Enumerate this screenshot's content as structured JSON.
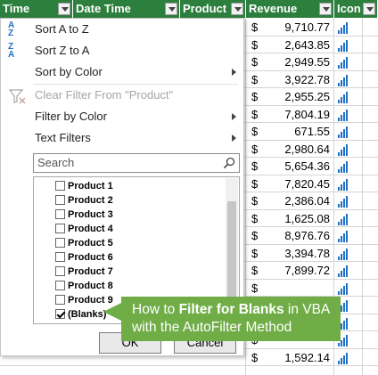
{
  "headers": {
    "time": "Time",
    "date_time": "Date Time",
    "product": "Product",
    "revenue": "Revenue",
    "icon": "Icon"
  },
  "revenue_rows": [
    {
      "cur": "$",
      "value": "9,710.77"
    },
    {
      "cur": "$",
      "value": "2,643.85"
    },
    {
      "cur": "$",
      "value": "2,949.55"
    },
    {
      "cur": "$",
      "value": "3,922.78"
    },
    {
      "cur": "$",
      "value": "2,955.25"
    },
    {
      "cur": "$",
      "value": "7,804.19"
    },
    {
      "cur": "$",
      "value": "671.55"
    },
    {
      "cur": "$",
      "value": "2,980.64"
    },
    {
      "cur": "$",
      "value": "5,654.36"
    },
    {
      "cur": "$",
      "value": "7,820.45"
    },
    {
      "cur": "$",
      "value": "2,386.04"
    },
    {
      "cur": "$",
      "value": "1,625.08"
    },
    {
      "cur": "$",
      "value": "8,976.76"
    },
    {
      "cur": "$",
      "value": "3,394.78"
    },
    {
      "cur": "$",
      "value": "7,899.72"
    },
    {
      "cur": "$",
      "value": ""
    },
    {
      "cur": "$",
      "value": ""
    },
    {
      "cur": "$",
      "value": ""
    },
    {
      "cur": "$",
      "value": ""
    },
    {
      "cur": "$",
      "value": "1,592.14"
    }
  ],
  "menu": {
    "sort_a_z": "Sort A to Z",
    "sort_z_a": "Sort Z to A",
    "sort_by_color": "Sort by Color",
    "clear_filter": "Clear Filter From \"Product\"",
    "filter_by_color": "Filter by Color",
    "text_filters": "Text Filters",
    "search_placeholder": "Search",
    "ok": "OK",
    "cancel": "Cancel"
  },
  "filter_items": [
    {
      "label": "Product 1",
      "checked": false
    },
    {
      "label": "Product 2",
      "checked": false
    },
    {
      "label": "Product 3",
      "checked": false
    },
    {
      "label": "Product 4",
      "checked": false
    },
    {
      "label": "Product 5",
      "checked": false
    },
    {
      "label": "Product 6",
      "checked": false
    },
    {
      "label": "Product 7",
      "checked": false
    },
    {
      "label": "Product 8",
      "checked": false
    },
    {
      "label": "Product 9",
      "checked": false
    },
    {
      "label": "(Blanks)",
      "checked": true
    }
  ],
  "callout": {
    "line1_pre": "How to ",
    "line1_bold": "Filter for Blanks",
    "line1_post": " in VBA",
    "line2": "with the AutoFilter Method"
  },
  "colors": {
    "header_bg": "#2d7f3e",
    "callout_bg": "#70ad47",
    "icon_bar": "#1f6fc5"
  }
}
